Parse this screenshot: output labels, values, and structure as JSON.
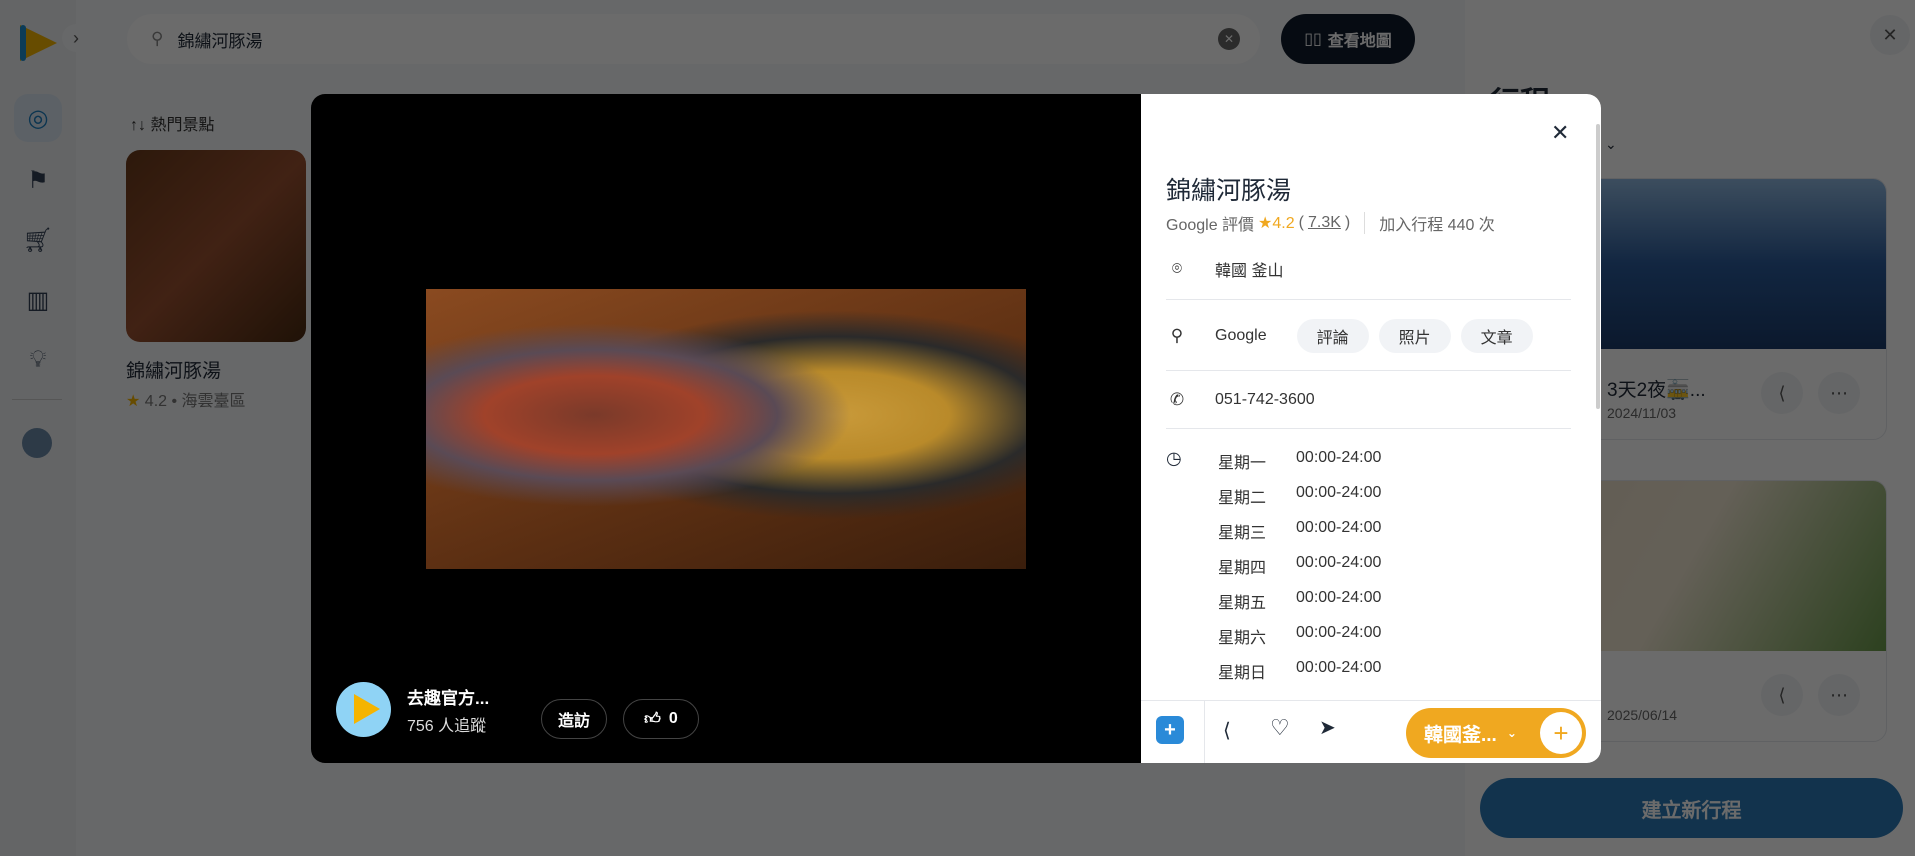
{
  "search": {
    "value": "錦繡河豚湯",
    "map_button": "查看地圖"
  },
  "list": {
    "sort_label": "熱門景點",
    "items": [
      {
        "title": "錦繡河豚湯",
        "rating": "4.2",
        "area": "海雲臺區"
      }
    ]
  },
  "sidebar": {
    "title": "行程",
    "trips": [
      {
        "title": "3天2夜🚋...",
        "date": "2024/11/03"
      },
      {
        "title": "",
        "date": "2025/06/14"
      }
    ],
    "create_button": "建立新行程"
  },
  "modal": {
    "creator": {
      "name": "去趣官方...",
      "followers": "756 人追蹤",
      "visit_button": "造訪",
      "likes": "0"
    },
    "place": {
      "name": "錦繡河豚湯",
      "rating_prefix": "Google 評價",
      "rating": "4.2",
      "reviews": "7.3K",
      "added": "加入行程 440 次",
      "location": "韓國 釜山",
      "search_label": "Google",
      "chips": [
        "評論",
        "照片",
        "文章"
      ],
      "phone": "051-742-3600",
      "hours": [
        {
          "day": "星期一",
          "time": "00:00-24:00"
        },
        {
          "day": "星期二",
          "time": "00:00-24:00"
        },
        {
          "day": "星期三",
          "time": "00:00-24:00"
        },
        {
          "day": "星期四",
          "time": "00:00-24:00"
        },
        {
          "day": "星期五",
          "time": "00:00-24:00"
        },
        {
          "day": "星期六",
          "time": "00:00-24:00"
        },
        {
          "day": "星期日",
          "time": "00:00-24:00"
        }
      ]
    },
    "footer": {
      "trip_select": "韓國釜...",
      "accent": "#f0a820"
    }
  }
}
